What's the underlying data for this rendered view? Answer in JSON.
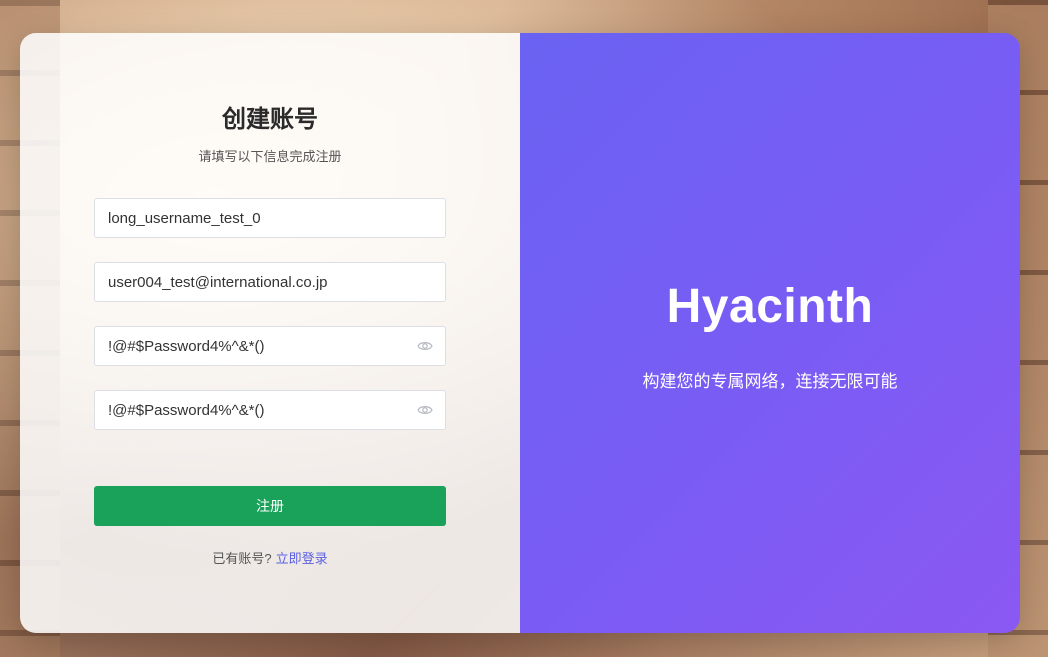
{
  "form": {
    "title": "创建账号",
    "subtitle": "请填写以下信息完成注册",
    "username_value": "long_username_test_0",
    "email_value": "user004_test@international.co.jp",
    "password_value": "!@#$Password4%^&*()",
    "confirm_password_value": "!@#$Password4%^&*()",
    "password_toggle_icon": "eye-icon",
    "submit_label": "注册",
    "have_account_text": "已有账号?",
    "login_link_label": "立即登录"
  },
  "brand_panel": {
    "name": "Hyacinth",
    "tagline": "构建您的专属网络，连接无限可能"
  },
  "colors": {
    "submit_button": "#1aa25a",
    "link": "#5b5fe3",
    "brand_gradient_start": "#6a62f2",
    "brand_gradient_end": "#8b58f2"
  }
}
